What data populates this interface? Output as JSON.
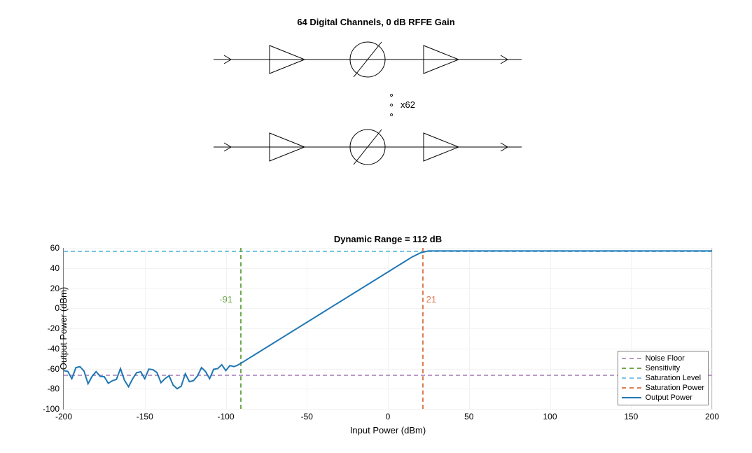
{
  "top_title": "64 Digital Channels, 0 dB RFFE Gain",
  "replicate_label": "x62",
  "chart_data": {
    "type": "line",
    "title": "Dynamic Range = 112 dB",
    "xlabel": "Input Power (dBm)",
    "ylabel": "Output Power (dBm)",
    "xlim": [
      -200,
      200
    ],
    "ylim": [
      -100,
      60
    ],
    "ref_lines": {
      "noise_floor_y": -66,
      "sensitivity_x": -91,
      "saturation_level_y": 57,
      "saturation_power_x": 21
    },
    "annotations": {
      "sensitivity_label": "-91",
      "saturation_power_label": "21"
    },
    "series": [
      {
        "name": "Output Power",
        "x": [
          -200,
          -195,
          -190,
          -185,
          -180,
          -175,
          -170,
          -165,
          -160,
          -155,
          -150,
          -145,
          -140,
          -135,
          -130,
          -125,
          -120,
          -115,
          -110,
          -105,
          -100,
          -95,
          -91,
          -85,
          -80,
          -75,
          -70,
          -65,
          -60,
          -55,
          -50,
          -45,
          -40,
          -35,
          -30,
          -25,
          -20,
          -15,
          -10,
          -5,
          0,
          5,
          10,
          15,
          20,
          25,
          30,
          35,
          40,
          200
        ],
        "y": [
          -62,
          -70,
          -58,
          -75,
          -63,
          -68,
          -72,
          -60,
          -78,
          -64,
          -70,
          -61,
          -74,
          -67,
          -80,
          -65,
          -72,
          -59,
          -70,
          -60,
          -62,
          -58,
          -55,
          -49,
          -44,
          -39,
          -34,
          -29,
          -24,
          -19,
          -14,
          -9,
          -4,
          1,
          6,
          11,
          16,
          21,
          26,
          31,
          36,
          41,
          46,
          51,
          55,
          57,
          57,
          57,
          57,
          57
        ]
      }
    ],
    "legend": [
      "Noise Floor",
      "Sensitivity",
      "Saturation Level",
      "Saturation Power",
      "Output Power"
    ],
    "colors": {
      "noise_floor": "#ba9bc9",
      "sensitivity": "#6fa84f",
      "saturation_level": "#79c5e6",
      "saturation_power": "#e07b54",
      "output_power": "#1f77b4"
    }
  }
}
